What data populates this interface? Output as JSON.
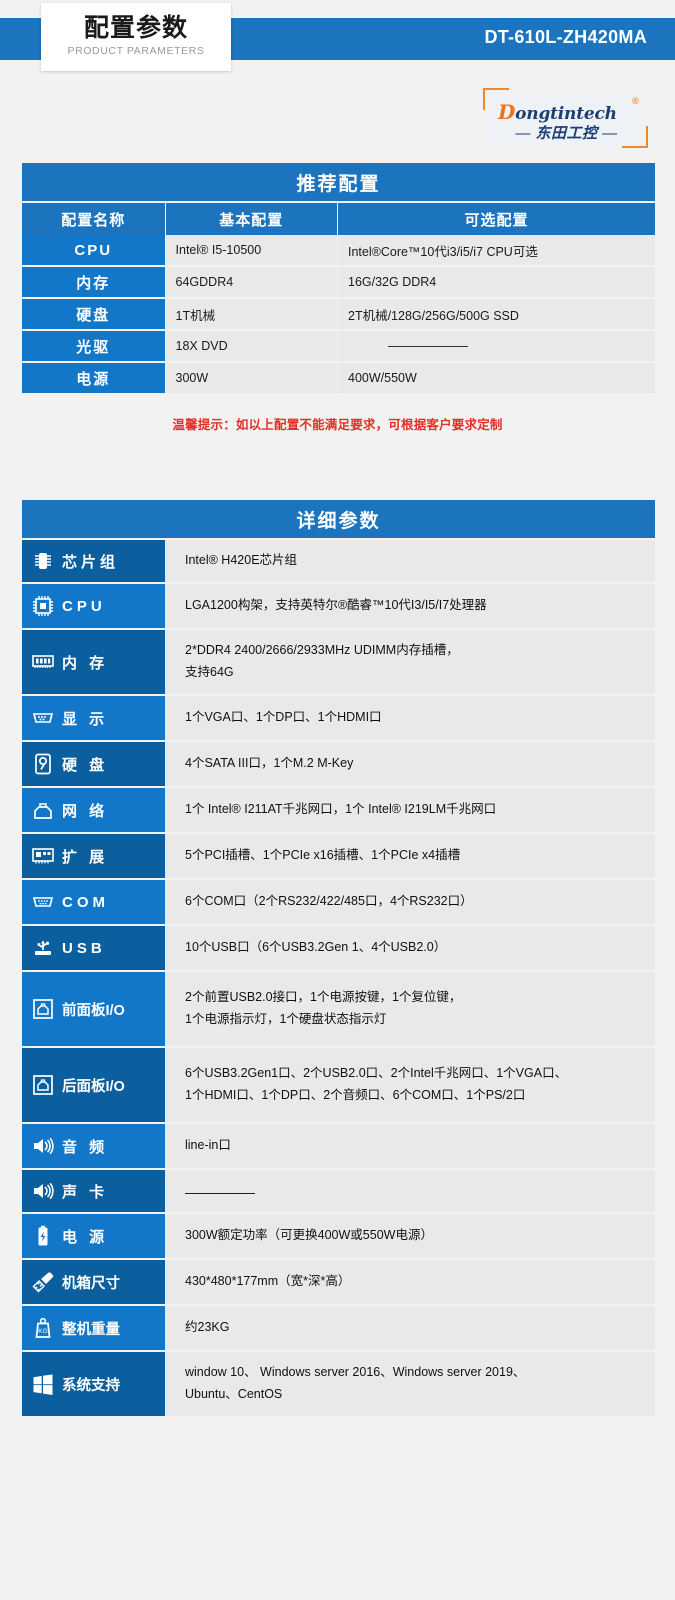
{
  "header": {
    "title_cn": "配置参数",
    "title_en": "PRODUCT PARAMETERS",
    "model": "DT-610L-ZH420MA",
    "band_color": "#1b74bd"
  },
  "logo": {
    "brand_d": "D",
    "brand_rest": "ongtintech",
    "registered": "®",
    "dash_left": "—",
    "brand_cn": "东田工控",
    "dash_right": "—",
    "orange": "#e8751a",
    "navy": "#1b3f73"
  },
  "recommended": {
    "title": "推荐配置",
    "columns": [
      "配置名称",
      "基本配置",
      "可选配置"
    ],
    "rows": [
      {
        "name": "CPU",
        "basic": "Intel® I5-10500",
        "optional": "Intel®Core™10代i3/i5/i7 CPU可选",
        "optional_is_dash": false
      },
      {
        "name": "内存",
        "basic": "64GDDR4",
        "optional": "16G/32G DDR4",
        "optional_is_dash": false
      },
      {
        "name": "硬盘",
        "basic": "1T机械",
        "optional": "2T机械/128G/256G/500G SSD",
        "optional_is_dash": false
      },
      {
        "name": "光驱",
        "basic": "18X DVD",
        "optional": "",
        "optional_is_dash": true
      },
      {
        "name": "电源",
        "basic": "300W",
        "optional": "400W/550W",
        "optional_is_dash": false
      }
    ]
  },
  "note": "温馨提示：如以上配置不能满足要求，可根据客户要求定制",
  "detail": {
    "title": "详细参数",
    "rows": [
      {
        "icon": "chipset-icon",
        "label": "芯片组",
        "lines": [
          "Intel® H420E芯片组"
        ]
      },
      {
        "icon": "cpu-icon",
        "label": "CPU",
        "lines": [
          "LGA1200构架，支持英特尔®酷睿™10代I3/I5/I7处理器"
        ]
      },
      {
        "icon": "memory-icon",
        "label": "内 存",
        "lines": [
          "2*DDR4 2400/2666/2933MHz  UDIMM内存插槽，",
          "支持64G"
        ]
      },
      {
        "icon": "display-icon",
        "label": "显 示",
        "lines": [
          "1个VGA口、1个DP口、1个HDMI口"
        ]
      },
      {
        "icon": "harddisk-icon",
        "label": "硬 盘",
        "lines": [
          "4个SATA III口，1个M.2 M-Key"
        ]
      },
      {
        "icon": "network-icon",
        "label": "网 络",
        "lines": [
          "1个 Intel® I211AT千兆网口，1个 Intel® I219LM千兆网口"
        ]
      },
      {
        "icon": "expansion-icon",
        "label": "扩 展",
        "lines": [
          "5个PCI插槽、1个PCIe x16插槽、1个PCIe x4插槽"
        ]
      },
      {
        "icon": "com-icon",
        "label": "COM",
        "lines": [
          "6个COM口（2个RS232/422/485口，4个RS232口）"
        ]
      },
      {
        "icon": "usb-icon",
        "label": "USB",
        "lines": [
          "10个USB口（6个USB3.2Gen 1、4个USB2.0）"
        ]
      },
      {
        "icon": "front-io-icon",
        "label": "前面板I/O",
        "lines": [
          "2个前置USB2.0接口，1个电源按键，1个复位键，",
          "1个电源指示灯，1个硬盘状态指示灯"
        ]
      },
      {
        "icon": "rear-io-icon",
        "label": "后面板I/O",
        "lines": [
          "6个USB3.2Gen1口、2个USB2.0口、2个Intel千兆网口、1个VGA口、",
          "1个HDMI口、1个DP口、2个音频口、6个COM口、1个PS/2口"
        ]
      },
      {
        "icon": "audio-icon",
        "label": "音 频",
        "lines": [
          "line-in口"
        ]
      },
      {
        "icon": "soundcard-icon",
        "label": "声 卡",
        "lines": [
          ""
        ]
      },
      {
        "icon": "power-icon",
        "label": "电 源",
        "lines": [
          "300W额定功率（可更换400W或550W电源）"
        ]
      },
      {
        "icon": "ruler-icon",
        "label": "机箱尺寸",
        "lines": [
          "430*480*177mm（宽*深*高）"
        ]
      },
      {
        "icon": "weight-icon",
        "label": "整机重量",
        "lines": [
          "约23KG"
        ]
      },
      {
        "icon": "windows-icon",
        "label": "系统支持",
        "lines": [
          "window 10、 Windows server 2016、Windows server 2019、",
          "Ubuntu、CentOS"
        ]
      }
    ]
  }
}
